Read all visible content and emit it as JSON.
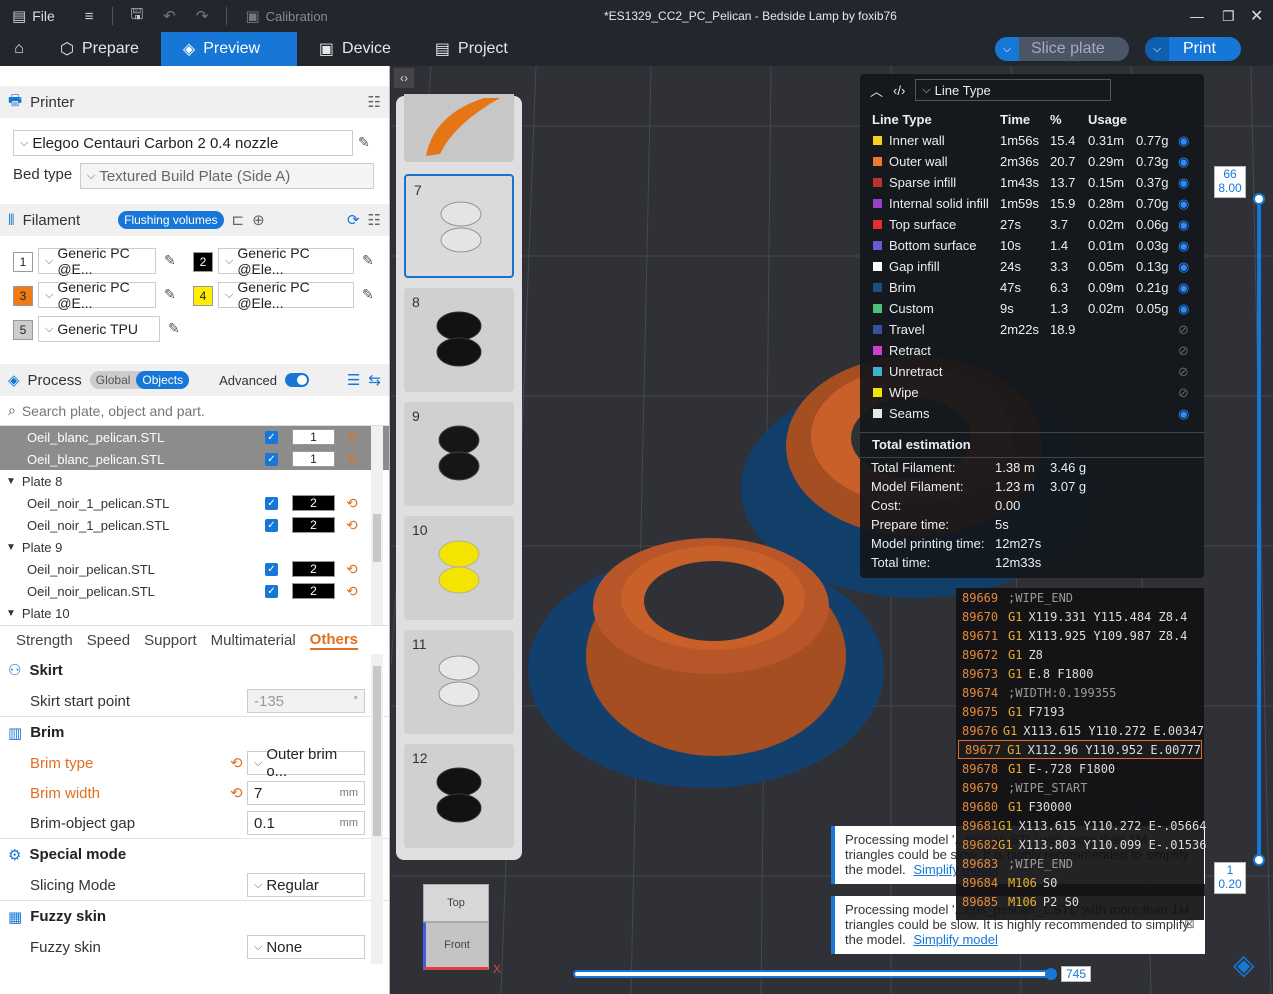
{
  "titlebar": {
    "file": "File",
    "calibration": "Calibration",
    "title": "*ES1329_CC2_PC_Pelican - Bedside Lamp by foxib76"
  },
  "tabs": {
    "prepare": "Prepare",
    "preview": "Preview",
    "device": "Device",
    "project": "Project"
  },
  "actions": {
    "slice": "Slice plate",
    "print": "Print"
  },
  "printer": {
    "heading": "Printer",
    "name": "Elegoo Centauri Carbon 2 0.4 nozzle",
    "bed_label": "Bed type",
    "bed_value": "Textured Build Plate (Side A)"
  },
  "filament": {
    "heading": "Filament",
    "flush": "Flushing volumes",
    "slots": [
      {
        "num": "1",
        "name": "Generic PC @E...",
        "color": "#ffffff",
        "text": "#222"
      },
      {
        "num": "2",
        "name": "Generic PC @Ele...",
        "color": "#000000",
        "text": "#fff"
      },
      {
        "num": "3",
        "name": "Generic PC @E...",
        "color": "#f07a14",
        "text": "#222"
      },
      {
        "num": "4",
        "name": "Generic PC @Ele...",
        "color": "#ffee00",
        "text": "#222"
      },
      {
        "num": "5",
        "name": "Generic TPU",
        "color": "#cccccc",
        "text": "#222"
      }
    ]
  },
  "process": {
    "heading": "Process",
    "global": "Global",
    "objects": "Objects",
    "advanced": "Advanced",
    "search_placeholder": "Search plate, object and part."
  },
  "tree": [
    {
      "type": "item",
      "name": "Oeil_blanc_pelican.STL",
      "count": "1",
      "sel": true,
      "color": "#ffffff",
      "text": "#222"
    },
    {
      "type": "item",
      "name": "Oeil_blanc_pelican.STL",
      "count": "1",
      "sel": true,
      "color": "#ffffff",
      "text": "#222"
    },
    {
      "type": "plate",
      "name": "Plate 8"
    },
    {
      "type": "item",
      "name": "Oeil_noir_1_pelican.STL",
      "count": "2",
      "sel": false,
      "color": "#000000",
      "text": "#fff"
    },
    {
      "type": "item",
      "name": "Oeil_noir_1_pelican.STL",
      "count": "2",
      "sel": false,
      "color": "#000000",
      "text": "#fff"
    },
    {
      "type": "plate",
      "name": "Plate 9"
    },
    {
      "type": "item",
      "name": "Oeil_noir_pelican.STL",
      "count": "2",
      "sel": false,
      "color": "#000000",
      "text": "#fff"
    },
    {
      "type": "item",
      "name": "Oeil_noir_pelican.STL",
      "count": "2",
      "sel": false,
      "color": "#000000",
      "text": "#fff"
    },
    {
      "type": "plate",
      "name": "Plate 10"
    }
  ],
  "subtabs": [
    "Strength",
    "Speed",
    "Support",
    "Multimaterial",
    "Others"
  ],
  "settings": {
    "skirt": "Skirt",
    "skirt_start": "Skirt start point",
    "skirt_start_val": "-135",
    "skirt_unit": "°",
    "brim": "Brim",
    "brim_type": "Brim type",
    "brim_type_val": "Outer brim o...",
    "brim_width": "Brim width",
    "brim_width_val": "7",
    "brim_gap": "Brim-object gap",
    "brim_gap_val": "0.1",
    "mm": "mm",
    "special": "Special mode",
    "slicing": "Slicing Mode",
    "slicing_val": "Regular",
    "fuzzy": "Fuzzy skin",
    "fuzzy_label": "Fuzzy skin",
    "fuzzy_val": "None"
  },
  "thumbs": [
    "7",
    "8",
    "9",
    "10",
    "11",
    "12"
  ],
  "legend": {
    "selector": "Line Type",
    "headers": [
      "Line Type",
      "Time",
      "%",
      "Usage"
    ],
    "rows": [
      {
        "name": "Inner wall",
        "color": "#f5d020",
        "time": "1m56s",
        "pct": "15.4",
        "m": "0.31m",
        "g": "0.77g",
        "vis": true
      },
      {
        "name": "Outer wall",
        "color": "#f07a2c",
        "time": "2m36s",
        "pct": "20.7",
        "m": "0.29m",
        "g": "0.73g",
        "vis": true
      },
      {
        "name": "Sparse infill",
        "color": "#b8342a",
        "time": "1m43s",
        "pct": "13.7",
        "m": "0.15m",
        "g": "0.37g",
        "vis": true
      },
      {
        "name": "Internal solid infill",
        "color": "#9a3fc8",
        "time": "1m59s",
        "pct": "15.9",
        "m": "0.28m",
        "g": "0.70g",
        "vis": true
      },
      {
        "name": "Top surface",
        "color": "#e23030",
        "time": "27s",
        "pct": "3.7",
        "m": "0.02m",
        "g": "0.06g",
        "vis": true
      },
      {
        "name": "Bottom surface",
        "color": "#6a5ad0",
        "time": "10s",
        "pct": "1.4",
        "m": "0.01m",
        "g": "0.03g",
        "vis": true
      },
      {
        "name": "Gap infill",
        "color": "#ffffff",
        "time": "24s",
        "pct": "3.3",
        "m": "0.05m",
        "g": "0.13g",
        "vis": true
      },
      {
        "name": "Brim",
        "color": "#1a4f80",
        "time": "47s",
        "pct": "6.3",
        "m": "0.09m",
        "g": "0.21g",
        "vis": true
      },
      {
        "name": "Custom",
        "color": "#4cc07a",
        "time": "9s",
        "pct": "1.3",
        "m": "0.02m",
        "g": "0.05g",
        "vis": true
      },
      {
        "name": "Travel",
        "color": "#3a4ea0",
        "time": "2m22s",
        "pct": "18.9",
        "m": "",
        "g": "",
        "vis": false
      },
      {
        "name": "Retract",
        "color": "#d040d0",
        "time": "",
        "pct": "",
        "m": "",
        "g": "",
        "vis": false
      },
      {
        "name": "Unretract",
        "color": "#40b0d0",
        "time": "",
        "pct": "",
        "m": "",
        "g": "",
        "vis": false
      },
      {
        "name": "Wipe",
        "color": "#f2e500",
        "time": "",
        "pct": "",
        "m": "",
        "g": "",
        "vis": false
      },
      {
        "name": "Seams",
        "color": "#e6e6e6",
        "time": "",
        "pct": "",
        "m": "",
        "g": "",
        "vis": true
      }
    ],
    "total_heading": "Total estimation",
    "totals": [
      {
        "k": "Total Filament:",
        "v1": "1.38 m",
        "v2": "3.46 g"
      },
      {
        "k": "Model Filament:",
        "v1": "1.23 m",
        "v2": "3.07 g"
      },
      {
        "k": "Cost:",
        "v1": "0.00",
        "v2": ""
      },
      {
        "k": "Prepare time:",
        "v1": "5s",
        "v2": ""
      },
      {
        "k": "Model printing time:",
        "v1": "12m27s",
        "v2": ""
      },
      {
        "k": "Total time:",
        "v1": "12m33s",
        "v2": ""
      }
    ]
  },
  "gcode": [
    {
      "n": "89669",
      "c": "",
      "a": ";WIPE_END"
    },
    {
      "n": "89670",
      "c": "G1",
      "a": "X119.331 Y115.484 Z8.4"
    },
    {
      "n": "89671",
      "c": "G1",
      "a": "X113.925 Y109.987 Z8.4"
    },
    {
      "n": "89672",
      "c": "G1",
      "a": "Z8"
    },
    {
      "n": "89673",
      "c": "G1",
      "a": "E.8 F1800"
    },
    {
      "n": "89674",
      "c": "",
      "a": ";WIDTH:0.199355"
    },
    {
      "n": "89675",
      "c": "G1",
      "a": "F7193"
    },
    {
      "n": "89676",
      "c": "G1",
      "a": "X113.615 Y110.272 E.00347"
    },
    {
      "n": "89677",
      "c": "G1",
      "a": "X112.96 Y110.952 E.00777",
      "hl": true
    },
    {
      "n": "89678",
      "c": "G1",
      "a": "E-.728 F1800"
    },
    {
      "n": "89679",
      "c": "",
      "a": ";WIPE_START"
    },
    {
      "n": "89680",
      "c": "G1",
      "a": "F30000"
    },
    {
      "n": "89681",
      "c": "G1",
      "a": "X113.615 Y110.272 E-.05664"
    },
    {
      "n": "89682",
      "c": "G1",
      "a": "X113.803 Y110.099 E-.01536"
    },
    {
      "n": "89683",
      "c": "",
      "a": ";WIPE_END"
    },
    {
      "n": "89684",
      "c": "M106",
      "a": "S0"
    },
    {
      "n": "89685",
      "c": "M106",
      "a": "P2 S0"
    }
  ],
  "notices": {
    "n1": "Processing model '...pelican.STL' with more than 1M triangles could be slow. It is highly recommended to simplify the model.",
    "n2": "Processing model '...eps_pelican_1.STL' with more than 1M triangles could be slow. It is highly recommended to simplify the model.",
    "link": "Simplify model"
  },
  "slider": {
    "top_layer": "66",
    "top_height": "8.00",
    "bottom_layer": "1",
    "bottom_height": "0.20",
    "h_value": "745"
  },
  "viewcube": {
    "top": "Top",
    "front": "Front"
  },
  "colors": {
    "accent": "#1677d6",
    "brim": "#1a4f80",
    "wall": "#c9602a"
  }
}
